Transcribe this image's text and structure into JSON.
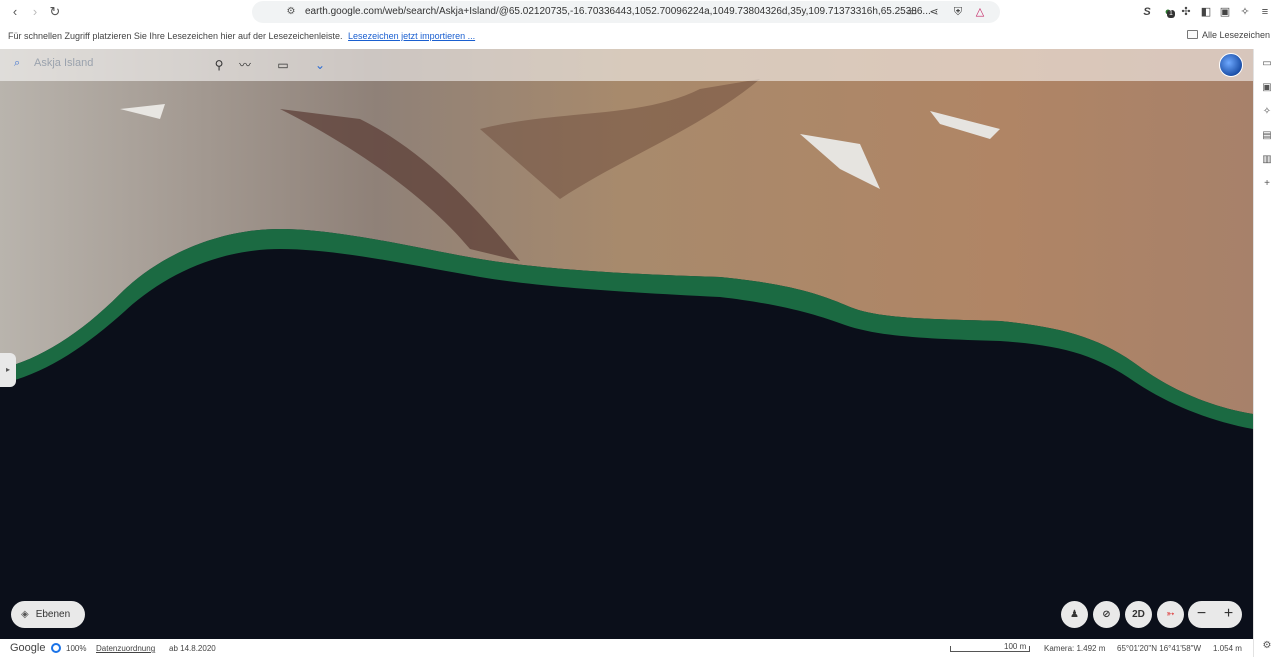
{
  "browser": {
    "url": "earth.google.com/web/search/Askja+Island/@65.02120735,-16.70336443,1052.70096224a,1049.73804326d,35y,109.71373316h,65.25386...",
    "bookmarks_hint": "Für schnellen Zugriff platzieren Sie Ihre Lesezeichen hier auf der Lesezeichenleiste.",
    "bookmarks_link": "Lesezeichen jetzt importieren ...",
    "all_bookmarks": "Alle Lesezeichen",
    "ext_badge": "1"
  },
  "earth": {
    "search_placeholder": "Askja Island",
    "layers_label": "Ebenen",
    "mode_2d": "2D"
  },
  "status": {
    "brand": "Google",
    "progress": "100%",
    "attribution": "Datenzuordnung",
    "date": "ab 14.8.2020",
    "scale": "100 m",
    "camera": "Kamera: 1.492 m",
    "coords": "65°01'20\"N 16°41'58\"W",
    "elevation": "1.054 m"
  },
  "colors": {
    "water": "#0b0f1a",
    "shore": "#1f7a4a",
    "accent": "#1a73e8"
  }
}
